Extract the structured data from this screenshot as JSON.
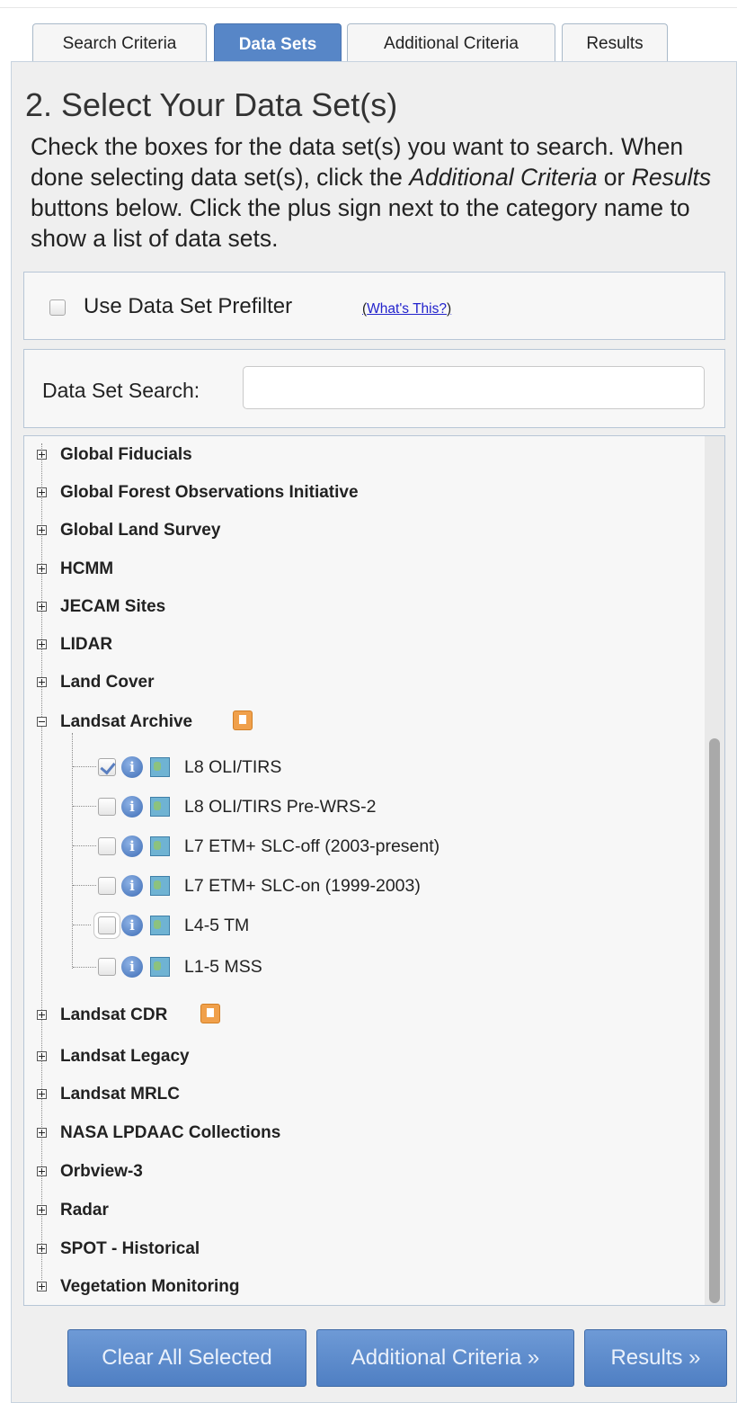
{
  "tabs": [
    {
      "label": "Search Criteria",
      "active": false
    },
    {
      "label": "Data Sets",
      "active": true
    },
    {
      "label": "Additional Criteria",
      "active": false
    },
    {
      "label": "Results",
      "active": false
    }
  ],
  "heading": "2. Select Your Data Set(s)",
  "instructions": {
    "part1": "Check the boxes for the data set(s) you want to search. When done selecting data set(s), click the ",
    "italic1": "Additional Criteria",
    "part2": " or ",
    "italic2": "Results",
    "part3": " buttons below. Click the plus sign next to the category name to show a list of data sets."
  },
  "prefilter": {
    "label": "Use Data Set Prefilter",
    "link_text": "What's This?",
    "checked": false
  },
  "search": {
    "label": "Data Set Search:",
    "value": "",
    "placeholder": ""
  },
  "tree": {
    "categories_top": [
      "Global Fiducials",
      "Global Forest Observations Initiative",
      "Global Land Survey",
      "HCMM",
      "JECAM Sites",
      "LIDAR",
      "Land Cover"
    ],
    "expanded_category": "Landsat Archive",
    "datasets": [
      {
        "label": "L8 OLI/TIRS",
        "checked": true
      },
      {
        "label": "L8 OLI/TIRS Pre-WRS-2",
        "checked": false
      },
      {
        "label": "L7 ETM+ SLC-off (2003-present)",
        "checked": false
      },
      {
        "label": "L7 ETM+ SLC-on (1999-2003)",
        "checked": false
      },
      {
        "label": "L4-5 TM",
        "checked": false
      },
      {
        "label": "L1-5 MSS",
        "checked": false
      }
    ],
    "categories_bottom": [
      "Landsat CDR",
      "Landsat Legacy",
      "Landsat MRLC",
      "NASA LPDAAC Collections",
      "Orbview-3",
      "Radar",
      "SPOT - Historical",
      "Vegetation Monitoring"
    ]
  },
  "buttons": {
    "clear": "Clear All Selected",
    "additional": "Additional Criteria »",
    "results": "Results »"
  },
  "colors": {
    "accent": "#5786c7",
    "button": "#5f8ccd",
    "bookmark": "#f0a04b"
  }
}
